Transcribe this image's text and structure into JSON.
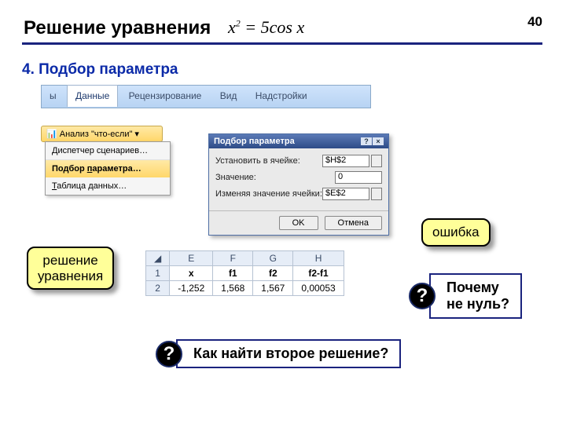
{
  "page_number": "40",
  "title": "Решение уравнения",
  "equation": {
    "lhs": "x",
    "exp": "2",
    "rhs": "= 5cos x"
  },
  "subtitle": "4. Подбор параметра",
  "ribbon": {
    "tabs": [
      "ы",
      "Данные",
      "Рецензирование",
      "Вид",
      "Надстройки"
    ],
    "active": "Данные"
  },
  "whatif_button": "Анализ \"что-если\"",
  "menu": {
    "items": [
      "Диспетчер сценариев…",
      "Подбор параметра…",
      "Таблица данных…"
    ],
    "selected_index": 1,
    "underline_chars": [
      "Д",
      "п",
      "Т"
    ]
  },
  "dialog": {
    "title": "Подбор параметра",
    "rows": [
      {
        "label": "Установить в ячейке:",
        "value": "$H$2",
        "picker": true
      },
      {
        "label": "Значение:",
        "value": "0",
        "picker": false
      },
      {
        "label": "Изменяя значение ячейки:",
        "value": "$E$2",
        "picker": true
      }
    ],
    "ok": "OK",
    "cancel": "Отмена"
  },
  "callouts": {
    "sol": "решение\nуравнения",
    "err": "ошибка"
  },
  "sheet": {
    "cols": [
      "E",
      "F",
      "G",
      "H"
    ],
    "headers": [
      "x",
      "f1",
      "f2",
      "f2-f1"
    ],
    "row_num_1": "1",
    "row_num_2": "2",
    "data": [
      "-1,252",
      "1,568",
      "1,567",
      "0,00053"
    ]
  },
  "questions": {
    "q1": "Почему\nне нуль?",
    "q2": "Как найти второе решение?",
    "mark": "?"
  }
}
